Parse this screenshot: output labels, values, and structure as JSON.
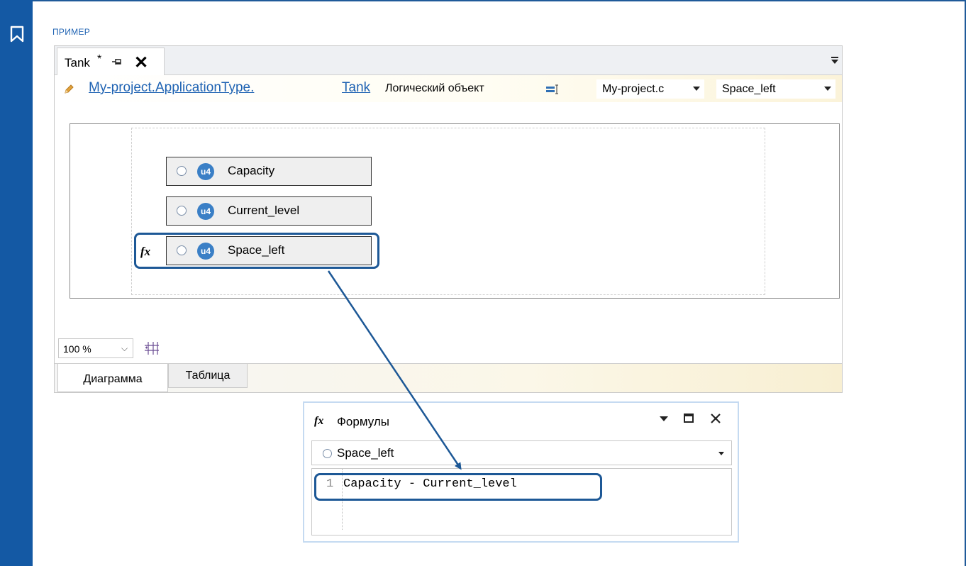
{
  "section_label": "ПРИМЕР",
  "document_tab": {
    "title": "Tank",
    "modified_marker": "*"
  },
  "path_bar": {
    "link_project": "My-project.ApplicationType.",
    "link_object": "Tank",
    "object_type": "Логический объект",
    "combo_project": "My-project.c",
    "combo_attribute": "Space_left"
  },
  "diagram": {
    "nodes": [
      {
        "badge": "u4",
        "name": "Capacity"
      },
      {
        "badge": "u4",
        "name": "Current_level"
      },
      {
        "badge": "u4",
        "name": "Space_left"
      }
    ],
    "formula_marker": "fx"
  },
  "zoom": {
    "value": "100 %"
  },
  "view_tabs": [
    "Диаграмма",
    "Таблица"
  ],
  "formulas_panel": {
    "title": "Формулы",
    "fx_label": "fx",
    "selected_attribute": "Space_left",
    "line_number": "1",
    "formula": "Capacity - Current_level"
  },
  "colors": {
    "sidebar": "#1459a4",
    "highlight": "#1d5896",
    "link": "#1f63b3",
    "badge": "#3a7fc6"
  },
  "icons": [
    "bookmark-icon",
    "pin-icon",
    "close-icon",
    "tab-menu-icon",
    "pencil-icon",
    "object-type-icon",
    "grid-icon",
    "dropdown-icon",
    "maximize-icon"
  ]
}
